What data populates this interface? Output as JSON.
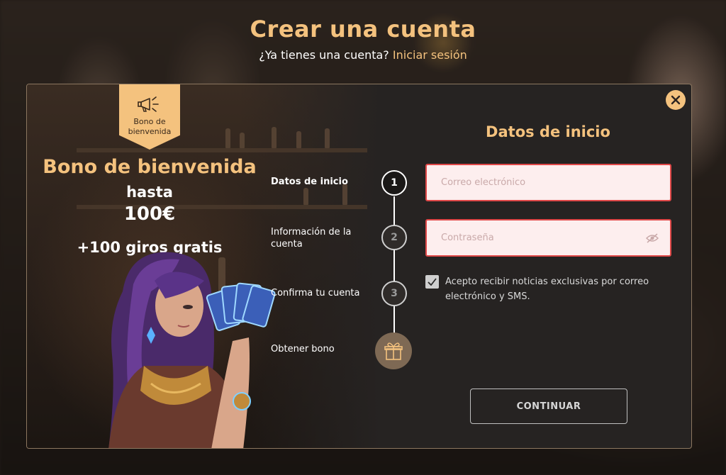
{
  "header": {
    "title": "Crear una cuenta",
    "login_prompt": "¿Ya tienes una cuenta?",
    "login_link": "Iniciar sesión"
  },
  "promo": {
    "badge_label": "Bono de bienvenida",
    "title": "Bono de bienvenida",
    "up_to": "hasta",
    "amount": "100€",
    "free_spins": "+100 giros gratis"
  },
  "steps": [
    {
      "number": "1",
      "label": "Datos de inicio",
      "active": true
    },
    {
      "number": "2",
      "label": "Información de la cuenta",
      "active": false
    },
    {
      "number": "3",
      "label": "Confirma tu cuenta",
      "active": false
    },
    {
      "number": "",
      "label": "Obtener bono",
      "icon": "gift-icon",
      "active": false
    }
  ],
  "form": {
    "title": "Datos de inicio",
    "email": {
      "placeholder": "Correo electrónico",
      "value": ""
    },
    "password": {
      "placeholder": "Contraseña",
      "value": ""
    },
    "consent_checked": true,
    "consent_text": "Acepto recibir noticias exclusivas por correo electrónico y SMS.",
    "continue_label": "CONTINUAR"
  },
  "colors": {
    "accent": "#f4c27e",
    "modal_bg": "#262322",
    "field_bg": "#fdeeee",
    "field_error_border": "#e04848"
  },
  "icons": {
    "close": "close-icon",
    "megaphone": "megaphone-icon",
    "eye": "eye-slash-icon",
    "check": "check-icon",
    "gift": "gift-icon"
  }
}
